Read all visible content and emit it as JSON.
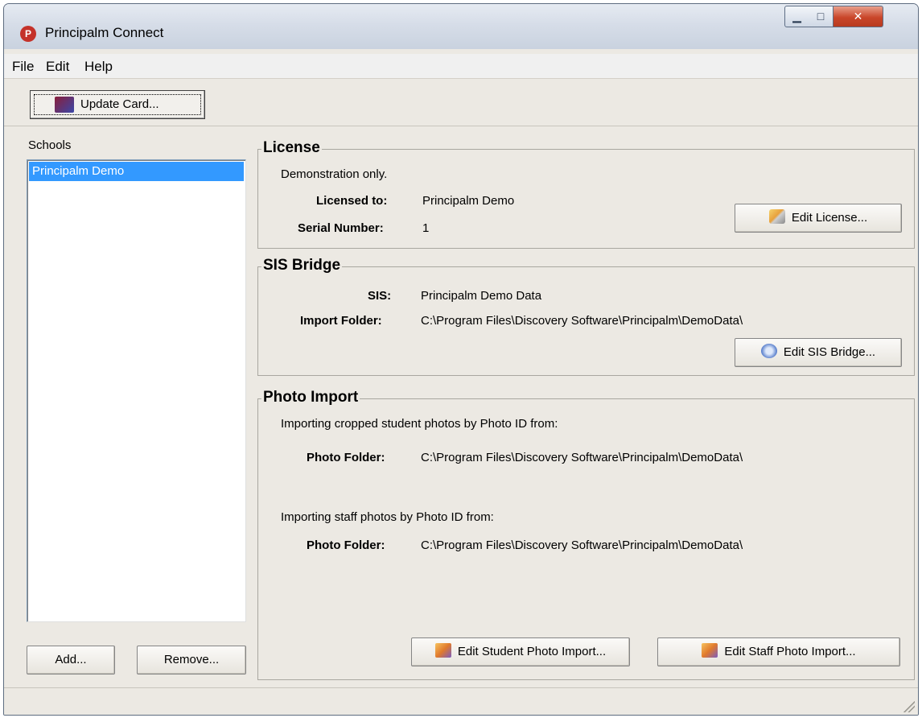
{
  "window": {
    "title": "Principalm Connect",
    "app_icon": "principalm-logo-icon"
  },
  "menu": {
    "items": [
      "File",
      "Edit",
      "Help"
    ]
  },
  "toolbar": {
    "update_card_label": "Update Card...",
    "icon": "update-card-icon"
  },
  "schools": {
    "label": "Schools",
    "items": [
      "Principalm Demo"
    ],
    "add_label": "Add...",
    "remove_label": "Remove..."
  },
  "license": {
    "title": "License",
    "status": "Demonstration only.",
    "licensed_to_label": "Licensed to:",
    "licensed_to_value": "Principalm Demo",
    "serial_label": "Serial Number:",
    "serial_value": "1",
    "edit_label": "Edit License..."
  },
  "sis": {
    "title": "SIS Bridge",
    "sis_label": "SIS:",
    "sis_value": "Principalm Demo Data",
    "folder_label": "Import Folder:",
    "folder_value": "C:\\Program Files\\Discovery Software\\Principalm\\DemoData\\",
    "edit_label": "Edit SIS Bridge..."
  },
  "photo": {
    "title": "Photo Import",
    "student_text": "Importing cropped student photos by Photo ID from:",
    "student_folder_label": "Photo Folder:",
    "student_folder_value": "C:\\Program Files\\Discovery Software\\Principalm\\DemoData\\",
    "staff_text": "Importing staff photos by Photo ID from:",
    "staff_folder_label": "Photo Folder:",
    "staff_folder_value": "C:\\Program Files\\Discovery Software\\Principalm\\DemoData\\",
    "edit_student_label": "Edit Student Photo Import...",
    "edit_staff_label": "Edit Staff Photo Import..."
  },
  "colors": {
    "selection": "#3399ff",
    "window_bg": "#ece9e3",
    "close_button": "#c9462a"
  }
}
